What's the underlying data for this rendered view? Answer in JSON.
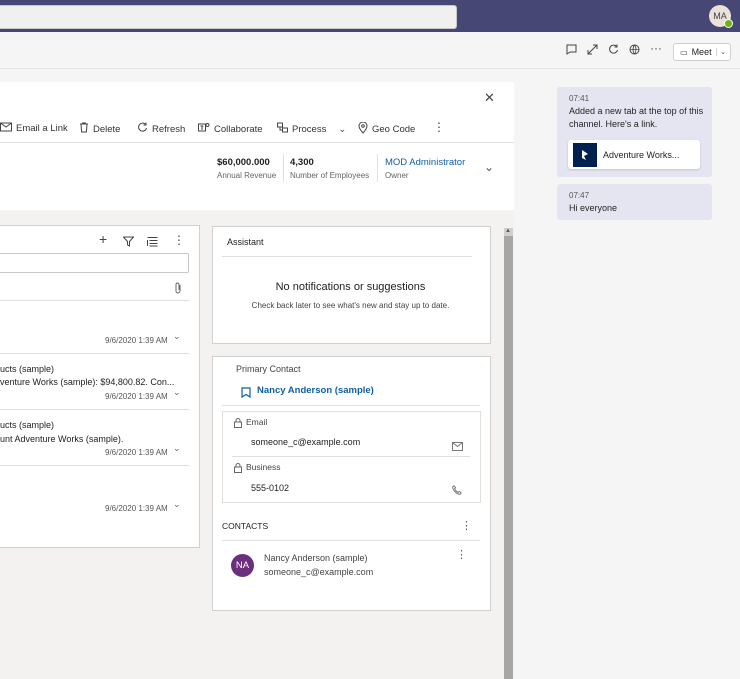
{
  "header": {
    "avatar_initials": "MA"
  },
  "subbar": {
    "meet_label": "Meet"
  },
  "toolbar": {
    "email_link": "Email a Link",
    "delete": "Delete",
    "refresh": "Refresh",
    "collaborate": "Collaborate",
    "process": "Process",
    "geo_code": "Geo Code"
  },
  "stats": {
    "revenue_value": "$60,000.000",
    "revenue_label": "Annual Revenue",
    "employees_value": "4,300",
    "employees_label": "Number of Employees",
    "owner_value": "MOD Administrator",
    "owner_label": "Owner"
  },
  "timeline": {
    "items": [
      {
        "line1": "",
        "line2": "",
        "date": "9/6/2020 1:39 AM"
      },
      {
        "line1": "ucts (sample)",
        "line2": "venture Works (sample): $94,800.82. Con...",
        "date": "9/6/2020 1:39 AM"
      },
      {
        "line1": "ucts (sample)",
        "line2": "unt Adventure Works (sample).",
        "date": "9/6/2020 1:39 AM"
      },
      {
        "line1": "",
        "line2": "",
        "date": "9/6/2020 1:39 AM"
      }
    ]
  },
  "assistant": {
    "title": "Assistant",
    "heading": "No notifications or suggestions",
    "subtext": "Check back later to see what's new and stay up to date."
  },
  "contact": {
    "primary_label": "Primary Contact",
    "primary_name": "Nancy Anderson (sample)",
    "email_label": "Email",
    "email_value": "someone_c@example.com",
    "business_label": "Business",
    "business_value": "555-0102",
    "contacts_header": "CONTACTS",
    "list": [
      {
        "initials": "NA",
        "name": "Nancy Anderson (sample)",
        "email": "someone_c@example.com"
      }
    ]
  },
  "chat": {
    "messages": [
      {
        "time": "07:41",
        "text": "Added a new tab at the top of this channel. Here's a link.",
        "card_title": "Adventure Works..."
      },
      {
        "time": "07:47",
        "text": "Hi everyone"
      }
    ]
  },
  "colors": {
    "teams_header": "#464775",
    "link_blue": "#115ea3",
    "avatar_purple": "#6b2f7d",
    "chat_bubble": "#e5e5f1"
  }
}
